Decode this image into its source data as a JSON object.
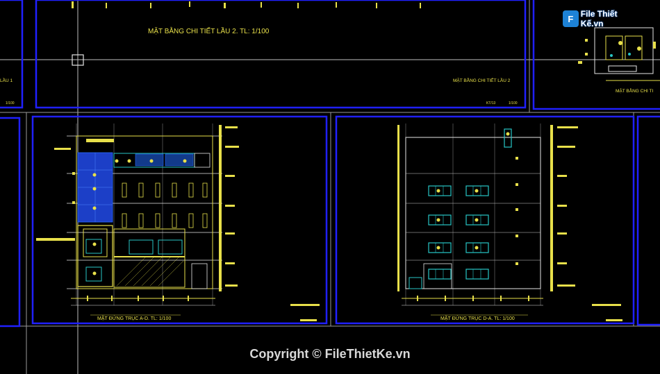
{
  "watermark": {
    "logo_text": "File Thiết Kế.vn",
    "logo_letter": "F",
    "copyright": "Copyright © FileThietKe.vn"
  },
  "sheets": {
    "top_plan_title": "MẶT BẰNG CHI TIẾT LẦU 2. TL: 1/100",
    "top_plan_label": "MẶT BẰNG CHI TIẾT LẦU 2",
    "top_plan_code": "KT/13",
    "top_plan_scale": "1/100",
    "left_partial_label": "LẦU 1",
    "left_partial_scale": "1/100",
    "right_partial_label": "MẶT BẰNG CHI TI",
    "elev_left_title": "MẶT ĐỨNG TRỤC A-D. TL: 1/100",
    "elev_right_title": "MẶT ĐỨNG TRỤC D-A. TL: 1/100"
  },
  "colors": {
    "background": "#000000",
    "frame_blue": "#1a1aff",
    "line_yellow": "#e8e04a",
    "line_white": "#cfcfcf",
    "glass_cyan": "#27c6c6",
    "hatch_blue": "#1c3fc7"
  }
}
